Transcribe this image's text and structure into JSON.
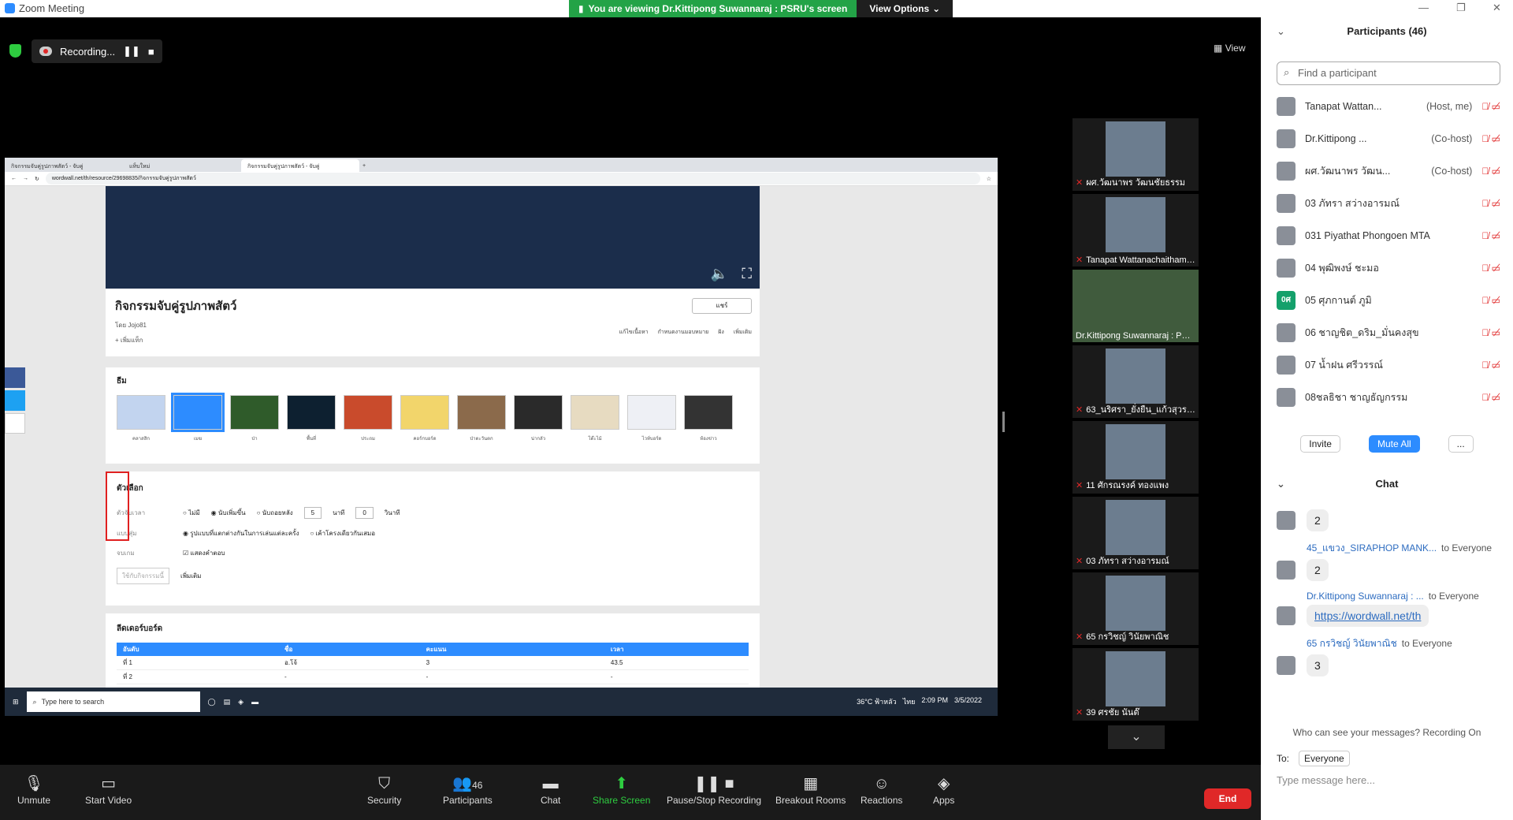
{
  "window": {
    "title": "Zoom Meeting"
  },
  "banner": {
    "viewing": "You are viewing Dr.Kittipong Suwannaraj : PSRU's screen",
    "view_options": "View Options"
  },
  "recording": {
    "label": "Recording..."
  },
  "view_button": "View",
  "shared": {
    "tabs": [
      "กิจกรรมจับคู่รูปภาพสัตว์ - จับคู่",
      "แท็บใหม่",
      "กิจกรรมจับคู่รูปภาพสัตว์ - จับคู่"
    ],
    "url": "wordwall.net/th/resource/29698835/กิจกรรมจับคู่รูปภาพสัตว์",
    "activity_title": "กิจกรรมจับคู่รูปภาพสัตว์",
    "by": "โดย Jojo81",
    "add_tag": "+ เพิ่มแท็ก",
    "share": "แชร์",
    "actions": [
      "แก้ไขเนื้อหา",
      "กำหนดงานมอบหมาย",
      "ฝัง",
      "เพิ่มเติม"
    ],
    "themes_label": "ธีม",
    "themes": [
      "คลาสสิก",
      "เมฆ",
      "ป่า",
      "พื้นที่",
      "ประถม",
      "คอร์กบอร์ด",
      "ป่าตะวันตก",
      "น่ากลัว",
      "โต๊ะไม้",
      "ไวท์บอร์ด",
      "ห้องข่าว"
    ],
    "options_label": "ตัวเลือก",
    "timer_key": "ตัวจับเวลา",
    "timer_opts": [
      "ไม่มี",
      "นับเพิ่มขึ้น",
      "นับถอยหลัง"
    ],
    "minutes": "5",
    "min_unit": "นาที",
    "seconds": "0",
    "sec_unit": "วินาที",
    "random_key": "แบบสุ่ม",
    "random_opts": [
      "รูปแบบที่แตกต่างกันในการเล่นแต่ละครั้ง",
      "เค้าโครงเดียวกันเสมอ"
    ],
    "end_key": "จบเกม",
    "end_opt": "แสดงคำตอบ",
    "apply": "ใช้กับกิจกรรมนี้",
    "more": "เพิ่มเติม",
    "leader_label": "ลีดเดอร์บอร์ด",
    "leader_headers": [
      "อันดับ",
      "ชื่อ",
      "คะแนน",
      "เวลา"
    ],
    "leader_rows": [
      [
        "ที่ 1",
        "อ.โจ้",
        "3",
        "43.5"
      ],
      [
        "ที่ 2",
        "-",
        "-",
        "-"
      ]
    ],
    "taskbar_search": "Type here to search",
    "tray": [
      "36°C ฟ้าหลัว",
      "ไทย",
      "2:09 PM",
      "3/5/2022"
    ]
  },
  "gallery": [
    "ผศ.วัฒนาพร วัฒนชัยธรรม",
    "Tanapat Wattanachaithamma",
    "Dr.Kittipong Suwannaraj : PSRU",
    "63_นริศรา_ยั่งยืน_แก้วสุวรรณ",
    "11 ศักรณรงค์ ทองแพง",
    "03 ภัทรา สว่างอารมณ์",
    "65 กรวิชญ์ วินัยพาณิช",
    "39 ศรชัย นันต๊"
  ],
  "toolbar": {
    "unmute": "Unmute",
    "start_video": "Start Video",
    "security": "Security",
    "participants": "Participants",
    "participants_count": "46",
    "chat": "Chat",
    "share_screen": "Share Screen",
    "pause_rec": "Pause/Stop Recording",
    "breakout": "Breakout Rooms",
    "reactions": "Reactions",
    "apps": "Apps",
    "end": "End"
  },
  "panel": {
    "participants_title": "Participants (46)",
    "find_placeholder": "Find a participant",
    "participants": [
      {
        "name": "Tanapat Wattan...",
        "role": "(Host, me)"
      },
      {
        "name": "Dr.Kittipong ...",
        "role": "(Co-host)"
      },
      {
        "name": "ผศ.วัฒนาพร วัฒน...",
        "role": "(Co-host)"
      },
      {
        "name": "03 ภัทรา สว่างอารมณ์",
        "role": ""
      },
      {
        "name": "031 Piyathat Phongoen MTA",
        "role": ""
      },
      {
        "name": "04 พุฒิพงษ์ ชะมอ",
        "role": ""
      },
      {
        "name": "05 ศุภกานต์ ภูมิ",
        "role": "",
        "avatar_text": "0ศ"
      },
      {
        "name": "06 ชาญชิต_ดริม_มั่นคงสุข",
        "role": ""
      },
      {
        "name": "07 น้ำฝน ศรีวรรณ์",
        "role": ""
      },
      {
        "name": "08ชลธิชา ชาญธัญกรรม",
        "role": ""
      }
    ],
    "invite": "Invite",
    "mute_all": "Mute All",
    "more": "...",
    "chat_title": "Chat",
    "chat": [
      {
        "from": "",
        "to": "",
        "text": "2"
      },
      {
        "from": "45_แขวง_SIRAPHOP MANK...",
        "to": "to Everyone",
        "text": "2"
      },
      {
        "from": "Dr.Kittipong Suwannaraj : ...",
        "to": "to Everyone",
        "text": "https://wordwall.net/th",
        "link": true
      },
      {
        "from": "65 กรวิชญ์ วินัยพาณิช",
        "to": "to Everyone",
        "text": "3"
      }
    ],
    "who_can_see": "Who can see your messages? Recording On",
    "to_label": "To:",
    "to_value": "Everyone",
    "input_placeholder": "Type message here..."
  }
}
